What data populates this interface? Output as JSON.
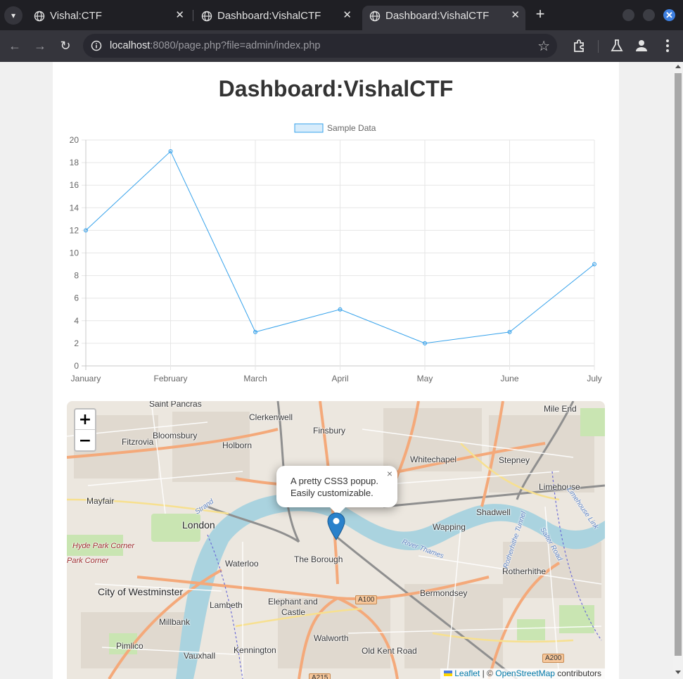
{
  "browser": {
    "tabs": [
      {
        "title": "Vishal:CTF",
        "active": false
      },
      {
        "title": "Dashboard:VishalCTF",
        "active": false
      },
      {
        "title": "Dashboard:VishalCTF",
        "active": true
      }
    ],
    "close_glyph": "✕",
    "new_tab_glyph": "+",
    "url": {
      "host": "localhost",
      "rest": ":8080/page.php?file=admin/index.php"
    }
  },
  "page": {
    "title": "Dashboard:VishalCTF"
  },
  "chart_data": {
    "type": "line",
    "title": "",
    "categories": [
      "January",
      "February",
      "March",
      "April",
      "May",
      "June",
      "July"
    ],
    "series": [
      {
        "name": "Sample Data",
        "values": [
          12,
          19,
          3,
          5,
          2,
          3,
          9
        ],
        "color": "#36a2eb",
        "fill": "rgba(54,162,235,0.2)"
      }
    ],
    "ylim": [
      0,
      20
    ],
    "yticks": [
      0,
      2,
      4,
      6,
      8,
      10,
      12,
      14,
      16,
      18,
      20
    ],
    "grid": true,
    "legend": "top-center"
  },
  "map": {
    "zoom_in": "+",
    "zoom_out": "−",
    "popup": {
      "line1": "A pretty CSS3 popup.",
      "line2": "Easily customizable.",
      "close": "×"
    },
    "labels": [
      {
        "text": "Saint Pancras",
        "cls": ""
      },
      {
        "text": "Clerkenwell",
        "cls": ""
      },
      {
        "text": "Mile End",
        "cls": ""
      },
      {
        "text": "Fitzrovia",
        "cls": ""
      },
      {
        "text": "Bloomsbury",
        "cls": ""
      },
      {
        "text": "Finsbury",
        "cls": ""
      },
      {
        "text": "Holborn",
        "cls": ""
      },
      {
        "text": "Whitechapel",
        "cls": ""
      },
      {
        "text": "Stepney",
        "cls": ""
      },
      {
        "text": "Limehouse",
        "cls": ""
      },
      {
        "text": "Mayfair",
        "cls": ""
      },
      {
        "text": "London",
        "cls": "big"
      },
      {
        "text": "Shadwell",
        "cls": ""
      },
      {
        "text": "Wapping",
        "cls": ""
      },
      {
        "text": "Hyde Park Corner",
        "cls": "italic"
      },
      {
        "text": "Park Corner",
        "cls": "italic"
      },
      {
        "text": "Waterloo",
        "cls": ""
      },
      {
        "text": "The Borough",
        "cls": ""
      },
      {
        "text": "Rotherhithe",
        "cls": ""
      },
      {
        "text": "City of Westminster",
        "cls": "big"
      },
      {
        "text": "Bermondsey",
        "cls": ""
      },
      {
        "text": "Lambeth",
        "cls": ""
      },
      {
        "text": "Elephant and",
        "cls": ""
      },
      {
        "text": "Castle",
        "cls": ""
      },
      {
        "text": "Millbank",
        "cls": ""
      },
      {
        "text": "Pimlico",
        "cls": ""
      },
      {
        "text": "Walworth",
        "cls": ""
      },
      {
        "text": "Kennington",
        "cls": ""
      },
      {
        "text": "Old Kent Road",
        "cls": ""
      },
      {
        "text": "Vauxhall",
        "cls": ""
      },
      {
        "text": "Strand",
        "cls": "water"
      },
      {
        "text": "River Thames",
        "cls": "water"
      },
      {
        "text": "Salter Road",
        "cls": "water"
      },
      {
        "text": "Rotherhithe Tunnel",
        "cls": "water"
      },
      {
        "text": "Limehouse Link",
        "cls": "water"
      }
    ],
    "shields": [
      "A100",
      "A200",
      "A215"
    ],
    "attribution": {
      "leaflet": "Leaflet",
      "sep": "| ©",
      "osm": "OpenStreetMap",
      "contributors": "contributors"
    }
  }
}
